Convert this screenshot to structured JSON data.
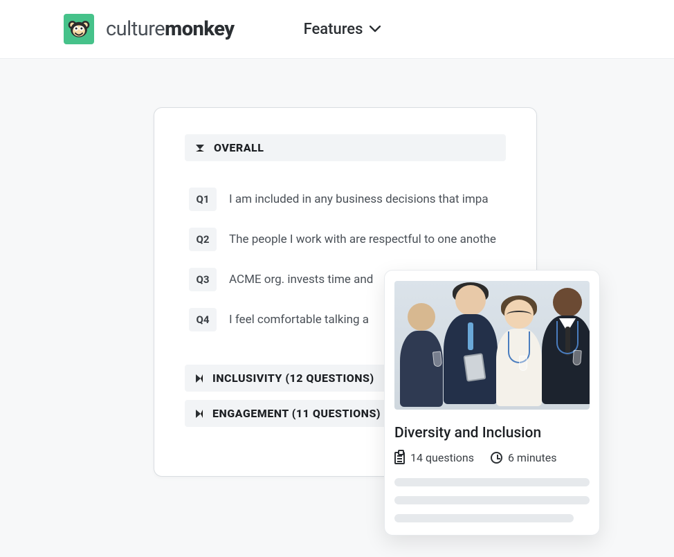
{
  "brand": {
    "light": "culture",
    "bold": "monkey"
  },
  "nav": {
    "features": "Features"
  },
  "panel": {
    "sections": [
      {
        "label": "OVERALL",
        "expanded": true
      },
      {
        "label": "INCLUSIVITY (12 QUESTIONS)",
        "expanded": false
      },
      {
        "label": "ENGAGEMENT (11 QUESTIONS)",
        "expanded": false
      }
    ],
    "questions": [
      {
        "tag": "Q1",
        "text": "I am included in any business decisions that impa"
      },
      {
        "tag": "Q2",
        "text": "The people I work with are respectful to one anothe"
      },
      {
        "tag": "Q3",
        "text": "ACME org. invests time and"
      },
      {
        "tag": "Q4",
        "text": "I feel comfortable talking a"
      }
    ]
  },
  "card": {
    "title": "Diversity and Inclusion",
    "questions_meta": "14 questions",
    "duration_meta": "6 minutes"
  }
}
